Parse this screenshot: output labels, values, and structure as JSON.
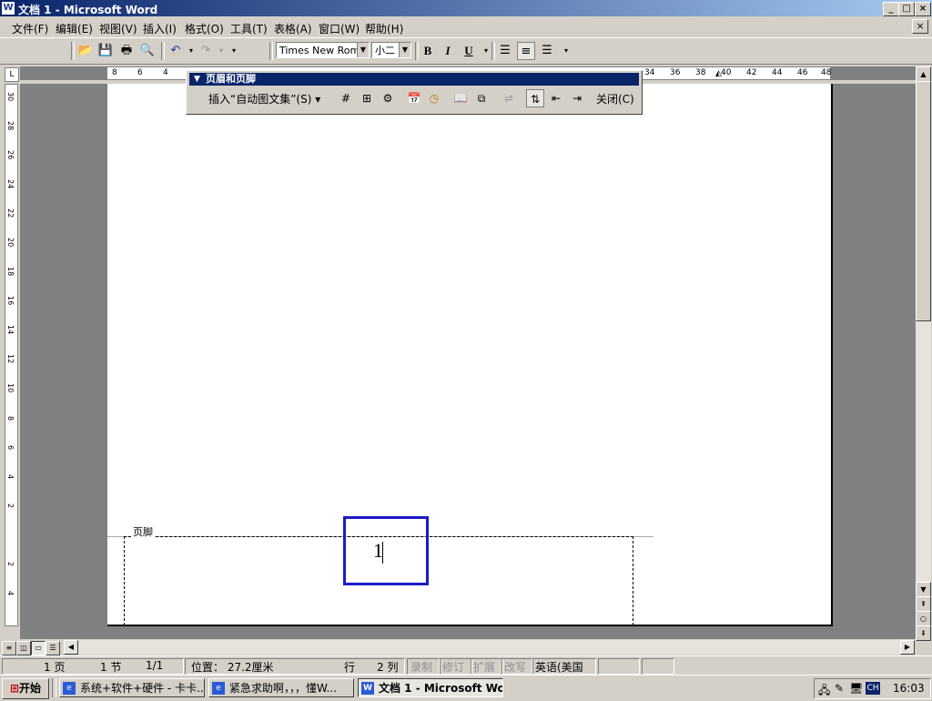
{
  "window": {
    "title": "文档 1 - Microsoft Word",
    "min": "_",
    "max": "□",
    "close": "×"
  },
  "menu": [
    "文件(F)",
    "编辑(E)",
    "视图(V)",
    "插入(I)",
    "格式(O)",
    "工具(T)",
    "表格(A)",
    "窗口(W)",
    "帮助(H)"
  ],
  "toolbar": {
    "font": "Times New Roman",
    "size": "小二",
    "bold": "B",
    "italic": "I",
    "underline": "U"
  },
  "ruler": {
    "h_left": [
      "8",
      "6",
      "4"
    ],
    "h_right": [
      "34",
      "36",
      "38",
      "40",
      "42",
      "44",
      "46",
      "48"
    ],
    "v": [
      "30",
      "28",
      "26",
      "24",
      "22",
      "20",
      "18",
      "16",
      "14",
      "12",
      "10",
      "8",
      "6",
      "4",
      "2",
      "2",
      "4"
    ]
  },
  "hf_toolbar": {
    "title": "页眉和页脚",
    "insert_autotext": "插入“自动图文集”(S) ▾",
    "close": "关闭(C)"
  },
  "document": {
    "footer_label": "页脚",
    "page_number": "1"
  },
  "status": {
    "page": "1 页",
    "section": "1 节",
    "pages": "1/1",
    "position": "位置： 27.2厘米",
    "line": "行",
    "col": "2 列",
    "rec": "录制",
    "trk": "修订",
    "ext": "扩展",
    "ovr": "改写",
    "lang": "英语(美国"
  },
  "taskbar": {
    "start": "开始",
    "tasks": [
      "系统+软件+硬件 - 卡卡...",
      "紧急求助啊，，，懂W...",
      "文档 1 - Microsoft Word"
    ],
    "ime": "CH",
    "clock": "16:03"
  }
}
